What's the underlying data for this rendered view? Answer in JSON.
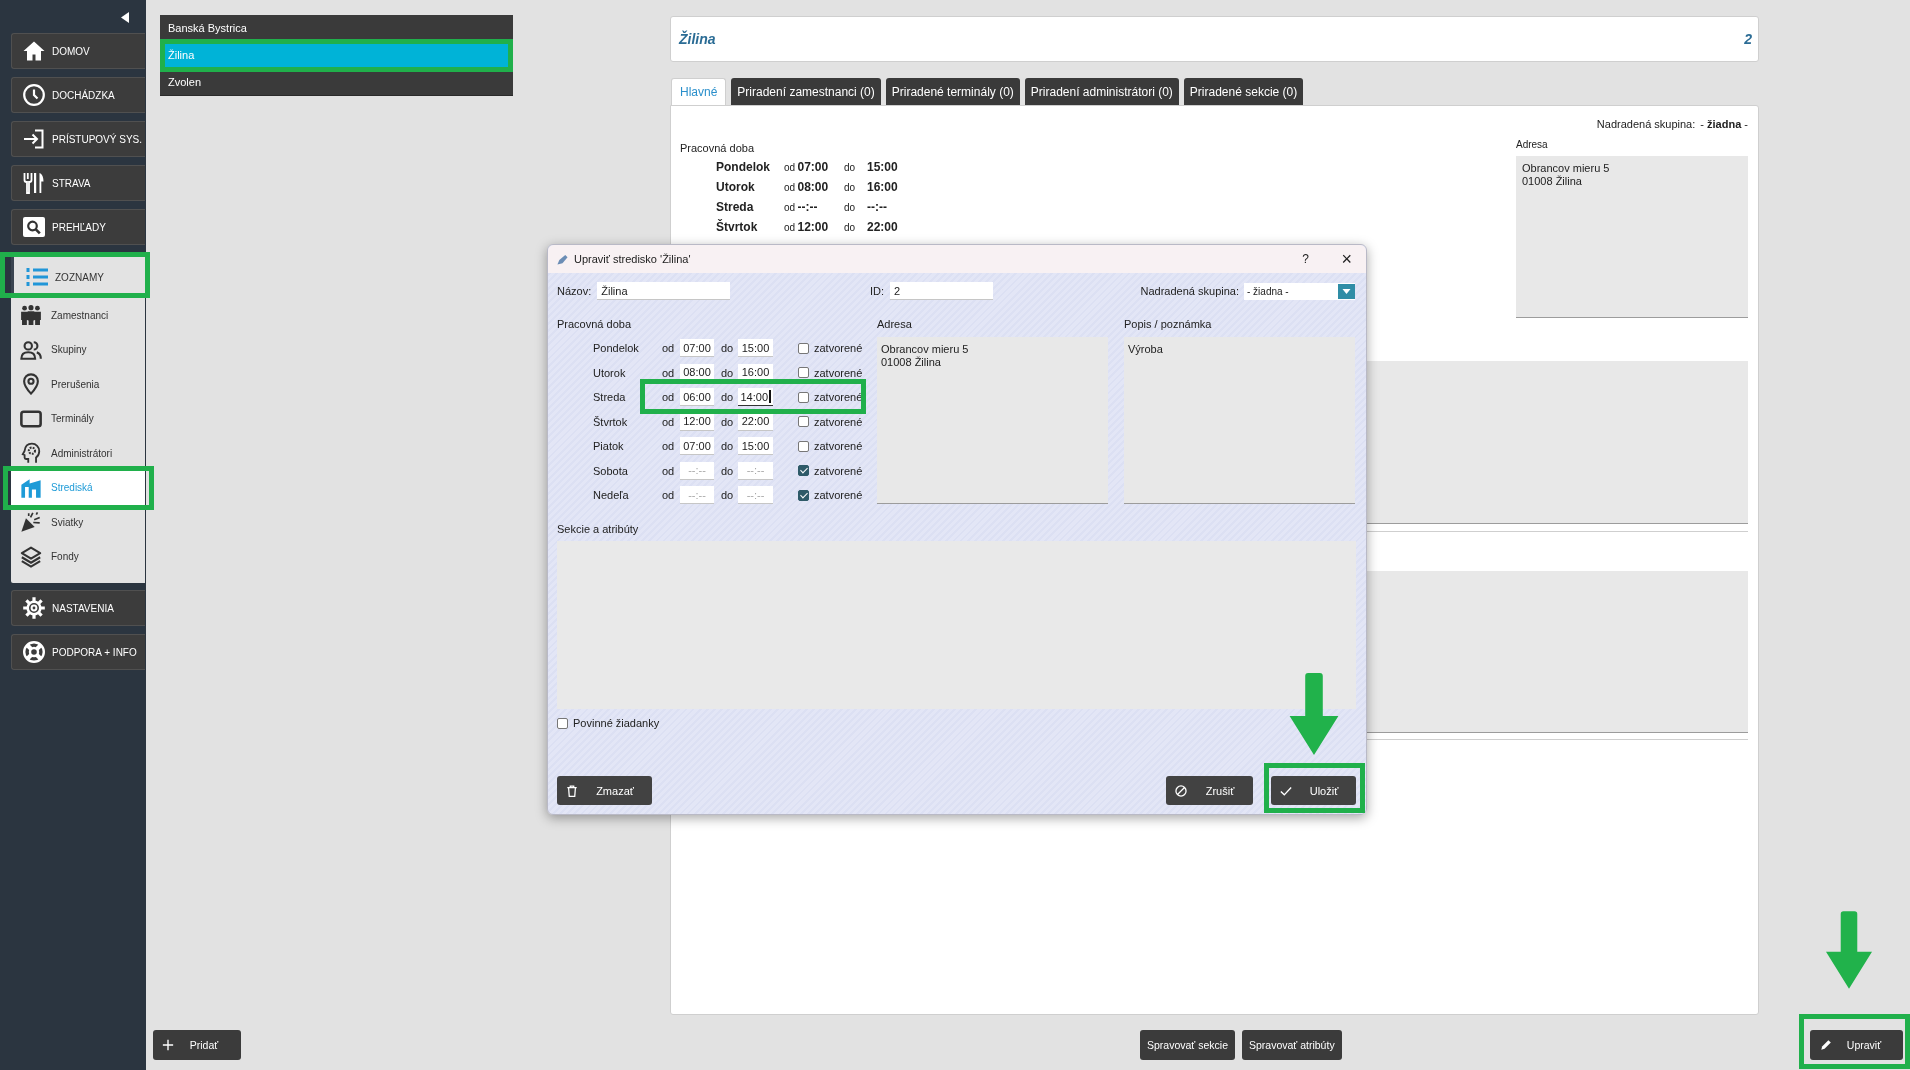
{
  "sidebar": {
    "items": [
      {
        "label": "DOMOV",
        "kind": "main",
        "highlighted": false
      },
      {
        "label": "DOCHÁDZKA",
        "kind": "main",
        "highlighted": false
      },
      {
        "label": "PRÍSTUPOVÝ SYS.",
        "kind": "main",
        "highlighted": false
      },
      {
        "label": "STRAVA",
        "kind": "main",
        "highlighted": false
      },
      {
        "label": "PREHĽADY",
        "kind": "main",
        "highlighted": false
      },
      {
        "label": "ZOZNAMY",
        "kind": "group",
        "highlighted": true,
        "children": [
          {
            "label": "Zamestnanci",
            "selected": false,
            "highlighted": false
          },
          {
            "label": "Skupiny",
            "selected": false,
            "highlighted": false
          },
          {
            "label": "Prerušenia",
            "selected": false,
            "highlighted": false
          },
          {
            "label": "Terminály",
            "selected": false,
            "highlighted": false
          },
          {
            "label": "Administrátori",
            "selected": false,
            "highlighted": false
          },
          {
            "label": "Strediská",
            "selected": true,
            "highlighted": true
          },
          {
            "label": "Sviatky",
            "selected": false,
            "highlighted": false
          },
          {
            "label": "Fondy",
            "selected": false,
            "highlighted": false
          }
        ]
      },
      {
        "label": "NASTAVENIA",
        "kind": "main",
        "highlighted": false
      },
      {
        "label": "PODPORA + INFO",
        "kind": "main",
        "highlighted": false
      }
    ]
  },
  "centers": [
    {
      "label": "Banská Bystrica",
      "selected": false,
      "highlighted": false
    },
    {
      "label": "Žilina",
      "selected": true,
      "highlighted": true
    },
    {
      "label": "Zvolen",
      "selected": false,
      "highlighted": false
    }
  ],
  "header": {
    "title": "Žilina",
    "id": "2"
  },
  "tabs": [
    {
      "label": "Hlavné",
      "selected": true
    },
    {
      "label": "Priradení zamestnanci (0)",
      "selected": false
    },
    {
      "label": "Priradené terminály (0)",
      "selected": false
    },
    {
      "label": "Priradení administrátori (0)",
      "selected": false
    },
    {
      "label": "Priradené sekcie (0)",
      "selected": false
    }
  ],
  "detail": {
    "parent_group_label": "Nadradená skupina:",
    "parent_group": "- **žiadna** -",
    "schedule_title": "Pracovná doba",
    "schedule": [
      {
        "day": "Pondelok",
        "from_label": "od",
        "from": "07:00",
        "to_label": "do",
        "to": "15:00"
      },
      {
        "day": "Utorok",
        "from_label": "od",
        "from": "08:00",
        "to_label": "do",
        "to": "16:00"
      },
      {
        "day": "Streda",
        "from_label": "od",
        "from": "--:--",
        "to_label": "do",
        "to": "--:--"
      },
      {
        "day": "Štvrtok",
        "from_label": "od",
        "from": "12:00",
        "to_label": "do",
        "to": "22:00"
      }
    ],
    "address_label": "Adresa",
    "address": "Obrancov mieru 5\n01008 Žilina"
  },
  "dialog": {
    "title": "Upraviť stredisko 'Žilina'",
    "help": "?",
    "close": "×",
    "name_label": "Názov:",
    "name": "Žilina",
    "id_label": "ID:",
    "id": "2",
    "parent_group_label": "Nadradená skupina:",
    "parent_group": "- žiadna -",
    "schedule_title": "Pracovná doba",
    "schedule": [
      {
        "day": "Pondelok",
        "from_label": "od",
        "from": "07:00",
        "to_label": "do",
        "to": "15:00",
        "closed_label": "zatvorené",
        "closed": false,
        "focused": false,
        "highlighted": false
      },
      {
        "day": "Utorok",
        "from_label": "od",
        "from": "08:00",
        "to_label": "do",
        "to": "16:00",
        "closed_label": "zatvorené",
        "closed": false,
        "focused": false,
        "highlighted": false
      },
      {
        "day": "Streda",
        "from_label": "od",
        "from": "06:00",
        "to_label": "do",
        "to": "14:00",
        "closed_label": "zatvorené",
        "closed": false,
        "focused": true,
        "highlighted": true
      },
      {
        "day": "Štvrtok",
        "from_label": "od",
        "from": "12:00",
        "to_label": "do",
        "to": "22:00",
        "closed_label": "zatvorené",
        "closed": false,
        "focused": false,
        "highlighted": false
      },
      {
        "day": "Piatok",
        "from_label": "od",
        "from": "07:00",
        "to_label": "do",
        "to": "15:00",
        "closed_label": "zatvorené",
        "closed": false,
        "focused": false,
        "highlighted": false
      },
      {
        "day": "Sobota",
        "from_label": "od",
        "from": "--:--",
        "to_label": "do",
        "to": "--:--",
        "closed_label": "zatvorené",
        "closed": true,
        "focused": false,
        "highlighted": false
      },
      {
        "day": "Nedeľa",
        "from_label": "od",
        "from": "--:--",
        "to_label": "do",
        "to": "--:--",
        "closed_label": "zatvorené",
        "closed": true,
        "focused": false,
        "highlighted": false
      }
    ],
    "address_label": "Adresa",
    "address": "Obrancov mieru 5\n01008 Žilina",
    "note_label": "Popis / poznámka",
    "note": "Výroba",
    "sections_label": "Sekcie a atribúty",
    "required_requests": {
      "label": "Povinné žiadanky",
      "checked": false
    },
    "buttons": [
      {
        "label": "Zmazať",
        "kind": "delete",
        "highlighted": false,
        "arrow": false
      },
      {
        "label": "Zrušiť",
        "kind": "cancel",
        "highlighted": false,
        "arrow": false
      },
      {
        "label": "Uložiť",
        "kind": "save",
        "highlighted": true,
        "arrow": true
      }
    ]
  },
  "bottom_bar": {
    "buttons": [
      {
        "label": "Pridať",
        "kind": "add",
        "highlighted": false,
        "arrow": false
      },
      {
        "label": "Spravovať sekcie",
        "kind": "plain",
        "highlighted": false,
        "arrow": false
      },
      {
        "label": "Spravovať atribúty",
        "kind": "plain",
        "highlighted": false,
        "arrow": false
      },
      {
        "label": "Upraviť",
        "kind": "edit",
        "highlighted": true,
        "arrow": true
      }
    ]
  }
}
